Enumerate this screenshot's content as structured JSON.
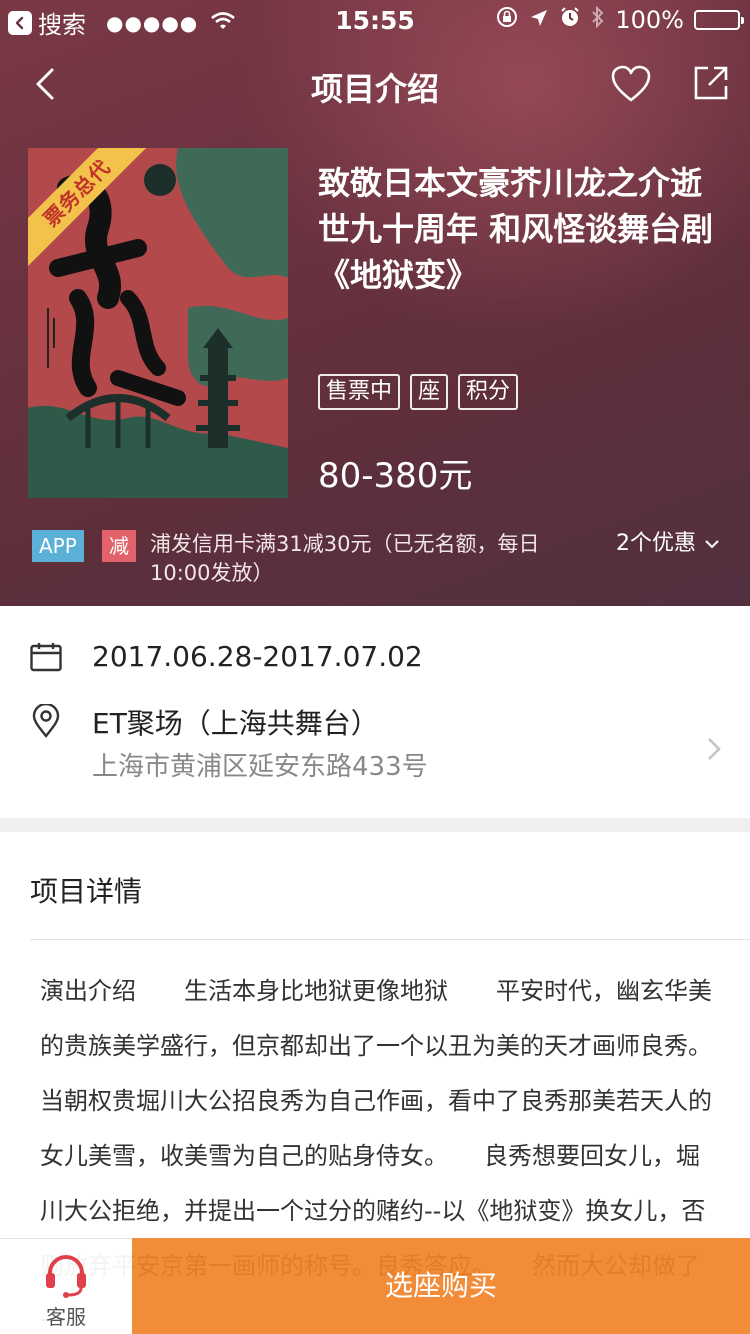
{
  "status_bar": {
    "carrier": "搜索",
    "signal": "●●●●●",
    "time": "15:55",
    "battery": "100%"
  },
  "nav": {
    "title": "项目介绍"
  },
  "poster": {
    "ribbon": "票务总代"
  },
  "event": {
    "title": "致敬日本文豪芥川龙之介逝世九十周年 和风怪谈舞台剧《地狱变》",
    "tags": [
      "售票中",
      "座",
      "积分"
    ],
    "price": "80-380元"
  },
  "promo": {
    "app_badge": "APP",
    "discount_badge": "减",
    "text": "浦发信用卡满31减30元（已无名额，每日10:00发放）",
    "count": "2个优惠"
  },
  "info": {
    "date": "2017.06.28-2017.07.02",
    "venue_name": "ET聚场（上海共舞台）",
    "venue_address": "上海市黄浦区延安东路433号"
  },
  "detail": {
    "title": "项目详情",
    "body": "演出介绍　　生活本身比地狱更像地狱　　平安时代，幽玄华美的贵族美学盛行，但京都却出了一个以丑为美的天才画师良秀。　　当朝权贵堀川大公招良秀为自己作画，看中了良秀那美若天人的女儿美雪，收美雪为自己的贴身侍女。　　良秀想要回女儿，堀川大公拒绝，并提出一个过分的赌约--以《地狱变》换女儿，否则放弃平安京第一画师的称号。良秀答应。　　然而大公却做了一"
  },
  "bottom": {
    "service_label": "客服",
    "buy_label": "选座购买"
  },
  "colors": {
    "hero_bg": "#6b3240",
    "buy_button": "#f28228",
    "service_icon": "#e0404a",
    "app_badge": "#5ab0d6",
    "discount_badge": "#e2646a"
  }
}
